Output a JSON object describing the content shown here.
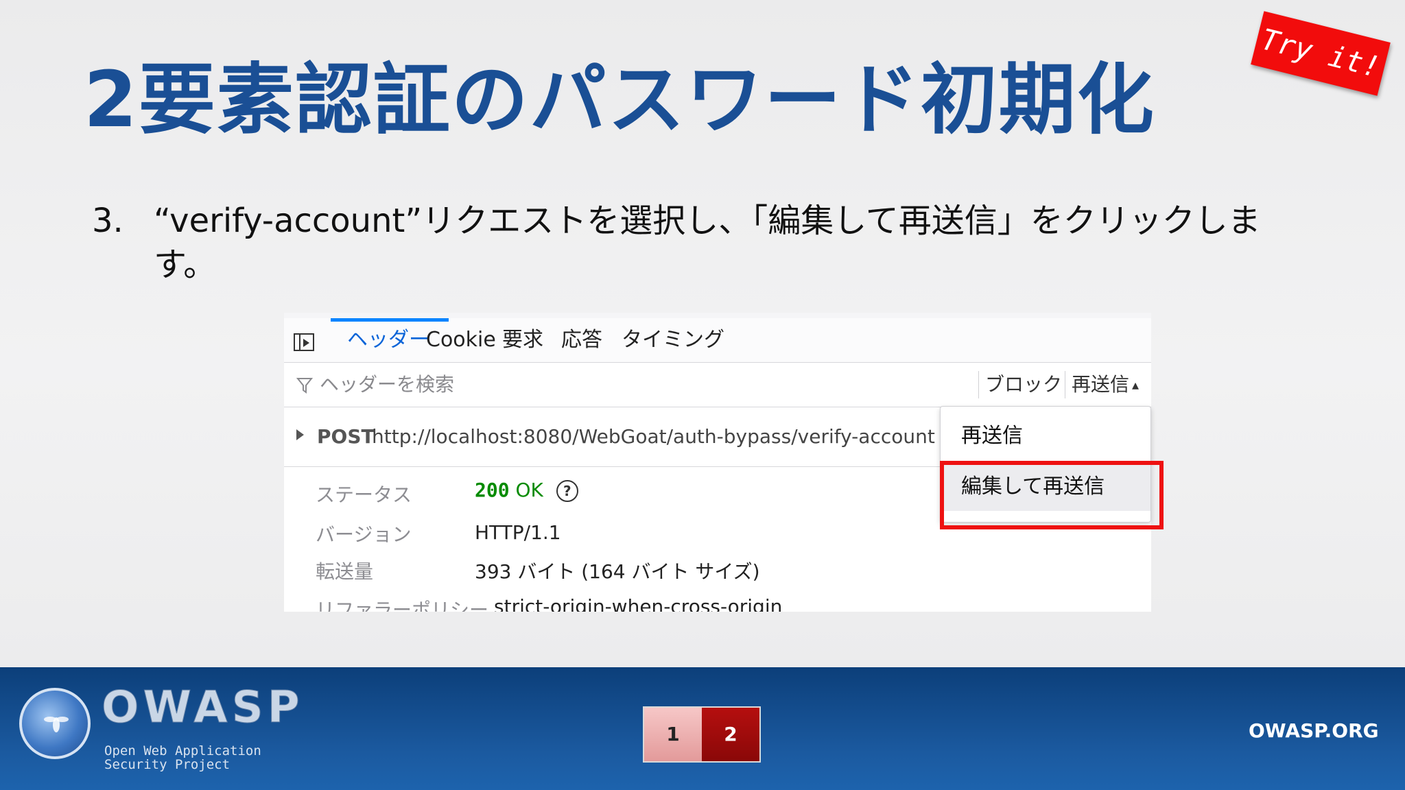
{
  "slide": {
    "title": "2要素認証のパスワード初期化",
    "badge": "Try it!",
    "step_number": "3.",
    "step_text": "“verify-account”リクエストを選択し、「編集して再送信」をクリックします。"
  },
  "devtools": {
    "tabs": [
      "ヘッダー",
      "Cookie",
      "要求",
      "応答",
      "タイミング"
    ],
    "active_tab": "ヘッダー",
    "filter_placeholder": "ヘッダーを検索",
    "block_label": "ブロック",
    "resend_label": "再送信",
    "request": {
      "method": "POST",
      "url": "http://localhost:8080/WebGoat/auth-bypass/verify-account"
    },
    "fields": {
      "status_key": "ステータス",
      "status_code": "200",
      "status_text": "OK",
      "version_key": "バージョン",
      "version_val": "HTTP/1.1",
      "transfer_key": "転送量",
      "transfer_val": "393 バイト (164 バイト サイズ)",
      "referrer_key": "リファラーポリシー",
      "referrer_val": "strict-origin-when-cross-origin"
    },
    "menu": {
      "item1": "再送信",
      "item2": "編集して再送信"
    },
    "colors": {
      "accent": "#0a84ff",
      "status_ok": "#058b00",
      "highlight": "#ee1111"
    }
  },
  "footer": {
    "logo": "OWASP",
    "logo_sub_1": "Open Web Application",
    "logo_sub_2": "Security Project",
    "pages": [
      "1",
      "2"
    ],
    "site": "OWASP.ORG"
  }
}
